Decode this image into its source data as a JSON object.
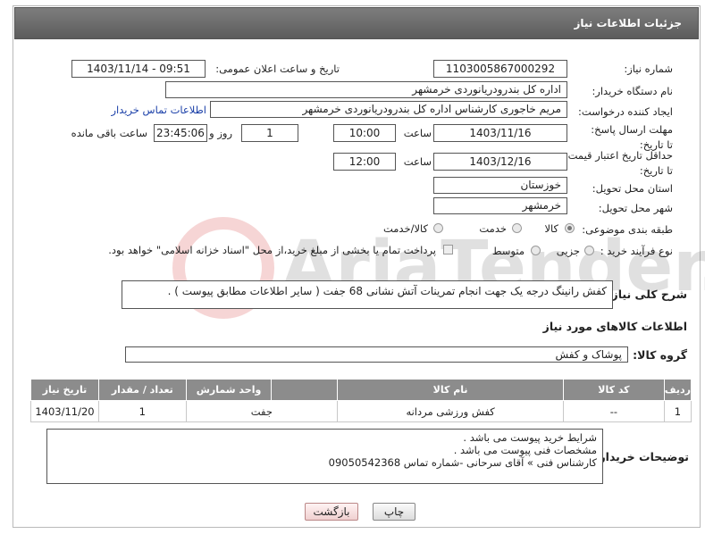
{
  "header": {
    "title": "جزئیات اطلاعات نیاز"
  },
  "fields": {
    "need_number_label": "شماره نیاز:",
    "need_number": "1103005867000292",
    "announce_label": "تاریخ و ساعت اعلان عمومی:",
    "announce_value": "1403/11/14 - 09:51",
    "buyer_org_label": "نام دستگاه خریدار:",
    "buyer_org": "اداره کل بندرودریانوردی خرمشهر",
    "creator_label": "ایجاد کننده درخواست:",
    "creator": "مریم خاجوری کارشناس اداره کل بندرودریانوردی خرمشهر",
    "contact_link": "اطلاعات تماس خریدار",
    "deadline_label": "مهلت ارسال پاسخ: تا تاریخ:",
    "deadline_date": "1403/11/16",
    "time_word": "ساعت",
    "deadline_time": "10:00",
    "days_value": "1",
    "days_word": "روز و",
    "remaining_time": "23:45:06",
    "remaining_word": "ساعت باقی مانده",
    "validity_label": "حداقل تاریخ اعتبار قیمت: تا تاریخ:",
    "validity_date": "1403/12/16",
    "validity_time": "12:00",
    "province_label": "استان محل تحویل:",
    "province": "خوزستان",
    "city_label": "شهر محل تحویل:",
    "city": "خرمشهر",
    "category_label": "طبقه بندی موضوعی:",
    "category_options": [
      "کالا",
      "خدمت",
      "کالا/خدمت"
    ],
    "category_selected": "کالا",
    "process_label": "نوع فرآیند خرید :",
    "process_options": [
      "جزیی",
      "متوسط"
    ],
    "process_selected": "جزیی",
    "payment_note": "پرداخت تمام یا بخشی از مبلغ خرید،از محل \"اسناد خزانه اسلامی\" خواهد بود."
  },
  "description": {
    "label": "شرح کلی نیاز:",
    "text": "کفش رانینگ درجه یک جهت انجام تمرینات آتش نشانی      68 جفت  (  سایر اطلاعات مطابق پیوست ) ."
  },
  "goods": {
    "section_title": "اطلاعات کالاهای مورد نیاز",
    "group_label": "گروه کالا:",
    "group_value": "پوشاک و کفش",
    "columns": [
      "ردیف",
      "کد کالا",
      "نام کالا",
      "واحد شمارش",
      "تعداد / مقدار",
      "تاریخ نیاز"
    ],
    "rows": [
      [
        "1",
        "--",
        "کفش ورزشی مردانه",
        "جفت",
        "1",
        "1403/11/20"
      ]
    ]
  },
  "buyer_notes": {
    "label": "توضیحات خریدار:",
    "lines": [
      "شرایط خرید پیوست می باشد .",
      "مشخصات فنی پیوست می باشد .",
      "کارشناس فنی » آقای سرحانی -شماره تماس  09050542368"
    ]
  },
  "buttons": {
    "print": "چاپ",
    "back": "بازگشت"
  },
  "watermark": {
    "text": "AriaTender.neT"
  }
}
